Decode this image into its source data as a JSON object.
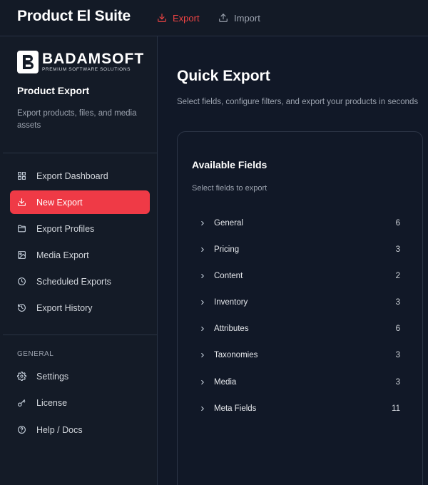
{
  "header": {
    "title": "Product El Suite",
    "tabs": [
      {
        "label": "Export",
        "icon": "download-icon"
      },
      {
        "label": "Import",
        "icon": "upload-icon"
      }
    ]
  },
  "sidebar": {
    "logo": {
      "name": "BADAMSOFT",
      "tagline": "PREMIUM SOFTWARE SOLUTIONS"
    },
    "title": "Product Export",
    "description": "Export products, files, and media assets",
    "items": [
      {
        "label": "Export Dashboard",
        "icon": "grid-icon"
      },
      {
        "label": "New Export",
        "icon": "download-icon"
      },
      {
        "label": "Export Profiles",
        "icon": "folder-icon"
      },
      {
        "label": "Media Export",
        "icon": "image-icon"
      },
      {
        "label": "Scheduled Exports",
        "icon": "clock-icon"
      },
      {
        "label": "Export History",
        "icon": "history-icon"
      }
    ],
    "section_label": "GENERAL",
    "general_items": [
      {
        "label": "Settings",
        "icon": "gear-icon"
      },
      {
        "label": "License",
        "icon": "key-icon"
      },
      {
        "label": "Help / Docs",
        "icon": "help-icon"
      }
    ]
  },
  "main": {
    "title": "Quick Export",
    "subtitle": "Select fields, configure filters, and export your products in seconds",
    "card": {
      "title": "Available Fields",
      "subtitle": "Select fields to export",
      "fields": [
        {
          "name": "General",
          "count": "6"
        },
        {
          "name": "Pricing",
          "count": "3"
        },
        {
          "name": "Content",
          "count": "2"
        },
        {
          "name": "Inventory",
          "count": "3"
        },
        {
          "name": "Attributes",
          "count": "6"
        },
        {
          "name": "Taxonomies",
          "count": "3"
        },
        {
          "name": "Media",
          "count": "3"
        },
        {
          "name": "Meta Fields",
          "count": "11"
        }
      ]
    }
  },
  "colors": {
    "accent": "#ef3a46",
    "background": "#111827",
    "sidebar": "#141b27"
  }
}
